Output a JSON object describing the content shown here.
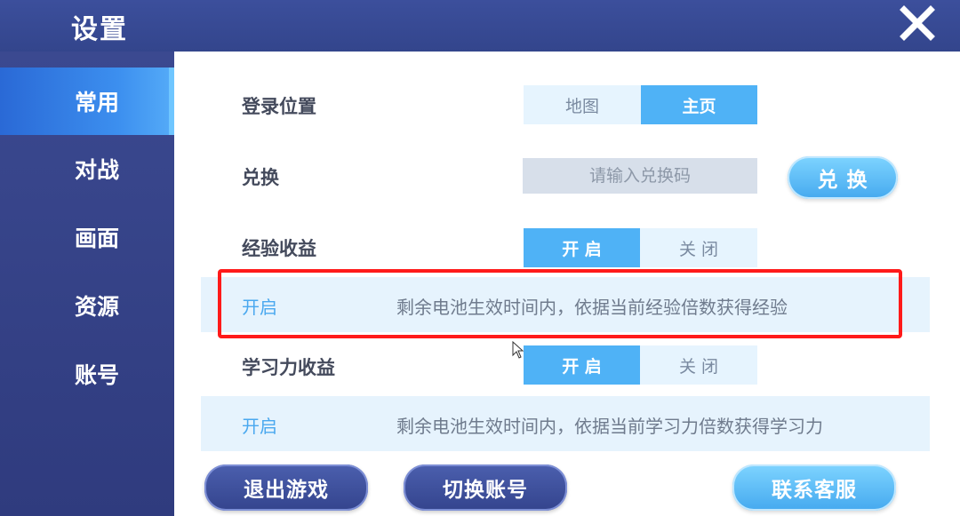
{
  "header": {
    "title": "设置"
  },
  "sidebar": {
    "items": [
      {
        "label": "常用",
        "active": true
      },
      {
        "label": "对战",
        "active": false
      },
      {
        "label": "画面",
        "active": false
      },
      {
        "label": "资源",
        "active": false
      },
      {
        "label": "账号",
        "active": false
      }
    ]
  },
  "settings": {
    "login_location": {
      "label": "登录位置",
      "options": [
        "地图",
        "主页"
      ],
      "selected": "主页"
    },
    "redeem": {
      "label": "兑换",
      "placeholder": "请输入兑换码",
      "value": "",
      "button": "兑 换"
    },
    "exp_gain": {
      "label": "经验收益",
      "options": [
        "开 启",
        "关 闭"
      ],
      "selected": "开 启",
      "info_state": "开启",
      "info_desc": "剩余电池生效时间内，依据当前经验倍数获得经验"
    },
    "study_gain": {
      "label": "学习力收益",
      "options": [
        "开 启",
        "关 闭"
      ],
      "selected": "开 启",
      "info_state": "开启",
      "info_desc": "剩余电池生效时间内，依据当前学习力倍数获得学习力"
    }
  },
  "footer": {
    "exit_game": "退出游戏",
    "switch_account": "切换账号",
    "contact_support": "联系客服"
  },
  "colors": {
    "header_bg": "#3c4f9c",
    "sidebar_bg": "#34428a",
    "accent": "#4fb2f6",
    "highlight": "#ff1a1a"
  },
  "icons": {
    "close": "close-x-icon",
    "cursor": "mouse-cursor-icon"
  }
}
